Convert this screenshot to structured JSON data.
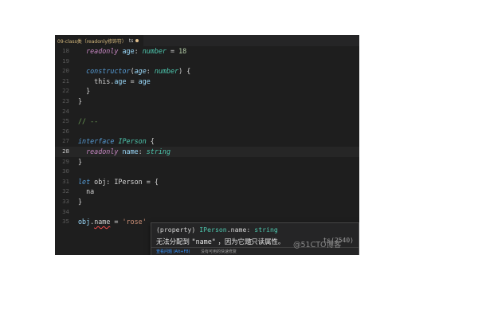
{
  "tab": {
    "title": "09-class类（readonly修饰符）",
    "ext": "ts"
  },
  "lines": [
    {
      "num": "18",
      "tokens": [
        [
          "",
          "  "
        ],
        [
          "k",
          "readonly"
        ],
        [
          "",
          " "
        ],
        [
          "p",
          "age"
        ],
        [
          "",
          ": "
        ],
        [
          "ty",
          "number"
        ],
        [
          "",
          " = "
        ],
        [
          "n",
          "18"
        ]
      ]
    },
    {
      "num": "19",
      "tokens": []
    },
    {
      "num": "20",
      "tokens": [
        [
          "",
          "  "
        ],
        [
          "fn",
          "constructor"
        ],
        [
          "",
          "("
        ],
        [
          "pi",
          "age"
        ],
        [
          "",
          ": "
        ],
        [
          "ty",
          "number"
        ],
        [
          "",
          ") {"
        ]
      ]
    },
    {
      "num": "21",
      "tokens": [
        [
          "",
          "    this."
        ],
        [
          "p",
          "age"
        ],
        [
          "",
          " = "
        ],
        [
          "p",
          "age"
        ]
      ]
    },
    {
      "num": "22",
      "tokens": [
        [
          "",
          "  }"
        ]
      ]
    },
    {
      "num": "23",
      "tokens": [
        [
          "",
          "}"
        ]
      ]
    },
    {
      "num": "24",
      "tokens": []
    },
    {
      "num": "25",
      "tokens": [
        [
          "c",
          "// --"
        ]
      ]
    },
    {
      "num": "26",
      "tokens": []
    },
    {
      "num": "27",
      "tokens": [
        [
          "kw",
          "interface"
        ],
        [
          "",
          " "
        ],
        [
          "ty",
          "IPerson"
        ],
        [
          "",
          " {"
        ]
      ]
    },
    {
      "num": "28",
      "tokens": [
        [
          "",
          "  "
        ],
        [
          "k",
          "readonly"
        ],
        [
          "",
          " "
        ],
        [
          "p",
          "name"
        ],
        [
          "",
          ": "
        ],
        [
          "ty",
          "string"
        ]
      ]
    },
    {
      "num": "29",
      "tokens": [
        [
          "",
          "}"
        ]
      ]
    },
    {
      "num": "30",
      "tokens": []
    },
    {
      "num": "31",
      "tokens": [
        [
          "kw",
          "let"
        ],
        [
          "",
          " obj: IPerson = {"
        ]
      ]
    },
    {
      "num": "32",
      "tokens": [
        [
          "",
          "  na"
        ]
      ]
    },
    {
      "num": "33",
      "tokens": [
        [
          "",
          "}"
        ]
      ]
    },
    {
      "num": "34",
      "tokens": []
    },
    {
      "num": "35",
      "tokens": [
        [
          "p",
          "obj"
        ],
        [
          "",
          "."
        ],
        [
          "err",
          "name"
        ],
        [
          "",
          " = "
        ],
        [
          "s",
          "'rose'"
        ]
      ]
    }
  ],
  "hover": {
    "sig_kind": "(property)",
    "sig_owner": "IPerson",
    "sig_prop": ".name",
    "sig_type": "string",
    "msg_pre": "无法分配到 ",
    "msg_name": "\"name\"",
    "msg_post": " ，因为它是只读属性。",
    "code_tag": "ts(2540)",
    "action_peek": "查看问题 (Alt+F8)",
    "action_fix": "没有可用的快速修复"
  },
  "watermark": "@51CTO博客"
}
